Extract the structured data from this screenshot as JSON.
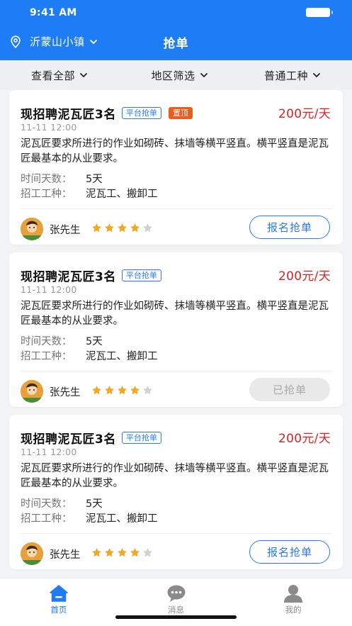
{
  "status_bar": {
    "time": "9:41 AM"
  },
  "nav": {
    "location": "沂蒙山小镇",
    "title": "抢单"
  },
  "filters": [
    {
      "label": "查看全部"
    },
    {
      "label": "地区筛选"
    },
    {
      "label": "普通工种"
    }
  ],
  "cards": [
    {
      "title": "现招聘泥瓦匠3名",
      "tag_platform": "平台抢单",
      "tag_top": "置顶",
      "price": "200元/天",
      "time": "11-11 12:00",
      "desc": "泥瓦匠要求所进行的作业如砌砖、抹墙等横平竖直。横平竖直是泥瓦匠最基本的从业要求。",
      "days_label": "时间天数：",
      "days_value": "5天",
      "types_label": "招工工种：",
      "types_value": "泥瓦工、搬卸工",
      "user": "张先生",
      "rating": 4,
      "rating_max": 5,
      "button": "报名抢单",
      "button_state": "active"
    },
    {
      "title": "现招聘泥瓦匠3名",
      "tag_platform": "平台抢单",
      "tag_top": "",
      "price": "200元/天",
      "time": "11-11 12:00",
      "desc": "泥瓦匠要求所进行的作业如砌砖、抹墙等横平竖直。横平竖直是泥瓦匠最基本的从业要求。",
      "days_label": "时间天数：",
      "days_value": "5天",
      "types_label": "招工工种：",
      "types_value": "泥瓦工、搬卸工",
      "user": "张先生",
      "rating": 4,
      "rating_max": 5,
      "button": "已抢单",
      "button_state": "done"
    },
    {
      "title": "现招聘泥瓦匠3名",
      "tag_platform": "平台抢单",
      "tag_top": "",
      "price": "200元/天",
      "time": "11-11 12:00",
      "desc": "泥瓦匠要求所进行的作业如砌砖、抹墙等横平竖直。横平竖直是泥瓦匠最基本的从业要求。",
      "days_label": "时间天数：",
      "days_value": "5天",
      "types_label": "招工工种：",
      "types_value": "泥瓦工、搬卸工",
      "user": "张先生",
      "rating": 4,
      "rating_max": 5,
      "button": "报名抢单",
      "button_state": "active"
    }
  ],
  "tabbar": [
    {
      "label": "首页",
      "icon": "home-icon",
      "active": true
    },
    {
      "label": "消息",
      "icon": "message-icon",
      "active": false
    },
    {
      "label": "我的",
      "icon": "profile-icon",
      "active": false
    }
  ],
  "colors": {
    "brand": "#1e7cf5",
    "price": "#e02020",
    "top_tag": "#f05a1a",
    "star_on": "#f5a623",
    "star_off": "#d0d0d0"
  }
}
